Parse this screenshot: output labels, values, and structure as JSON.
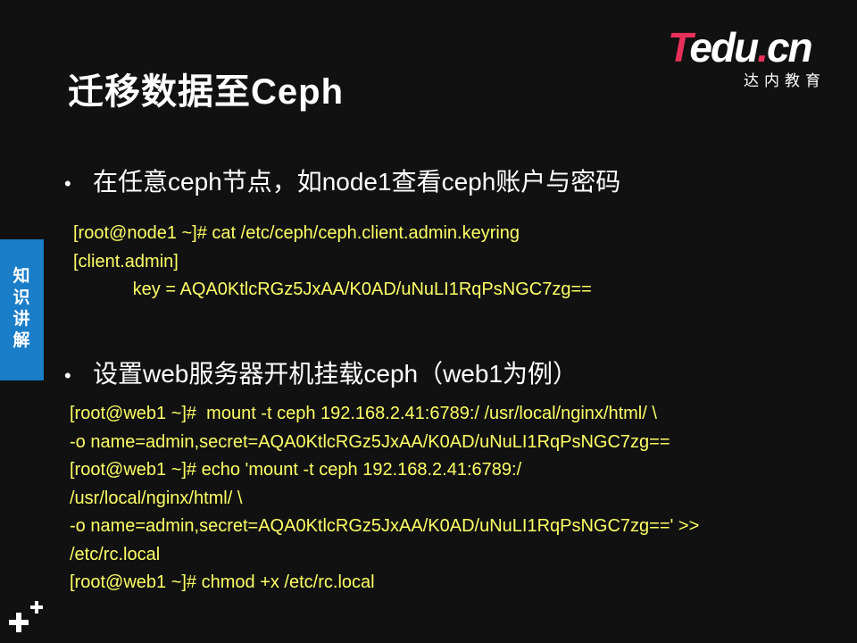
{
  "slide": {
    "title": "迁移数据至Ceph",
    "logo": {
      "main_t": "T",
      "main_edu": "edu",
      "main_dot": ".",
      "main_cn": "cn",
      "sub": "达内教育"
    },
    "side_tab": {
      "label": "知识讲解"
    },
    "bullets": [
      {
        "text": "在任意ceph节点，如node1查看ceph账户与密码",
        "code_lines": [
          "[root@node1 ~]# cat /etc/ceph/ceph.client.admin.keyring",
          "[client.admin]",
          "            key = AQA0KtlcRGz5JxAA/K0AD/uNuLI1RqPsNGC7zg=="
        ]
      },
      {
        "text": "设置web服务器开机挂载ceph（web1为例）",
        "code_lines": [
          "[root@web1 ~]#  mount -t ceph 192.168.2.41:6789:/ /usr/local/nginx/html/ \\",
          "-o name=admin,secret=AQA0KtlcRGz5JxAA/K0AD/uNuLI1RqPsNGC7zg==",
          "[root@web1 ~]# echo 'mount -t ceph 192.168.2.41:6789:/",
          "/usr/local/nginx/html/ \\",
          "-o name=admin,secret=AQA0KtlcRGz5JxAA/K0AD/uNuLI1RqPsNGC7zg==' >>",
          "/etc/rc.local",
          "[root@web1 ~]# chmod +x /etc/rc.local"
        ]
      }
    ],
    "colors": {
      "background": "#111111",
      "code": "#ffff66",
      "tab": "#1a7dc8",
      "brand": "#e8305a"
    }
  }
}
